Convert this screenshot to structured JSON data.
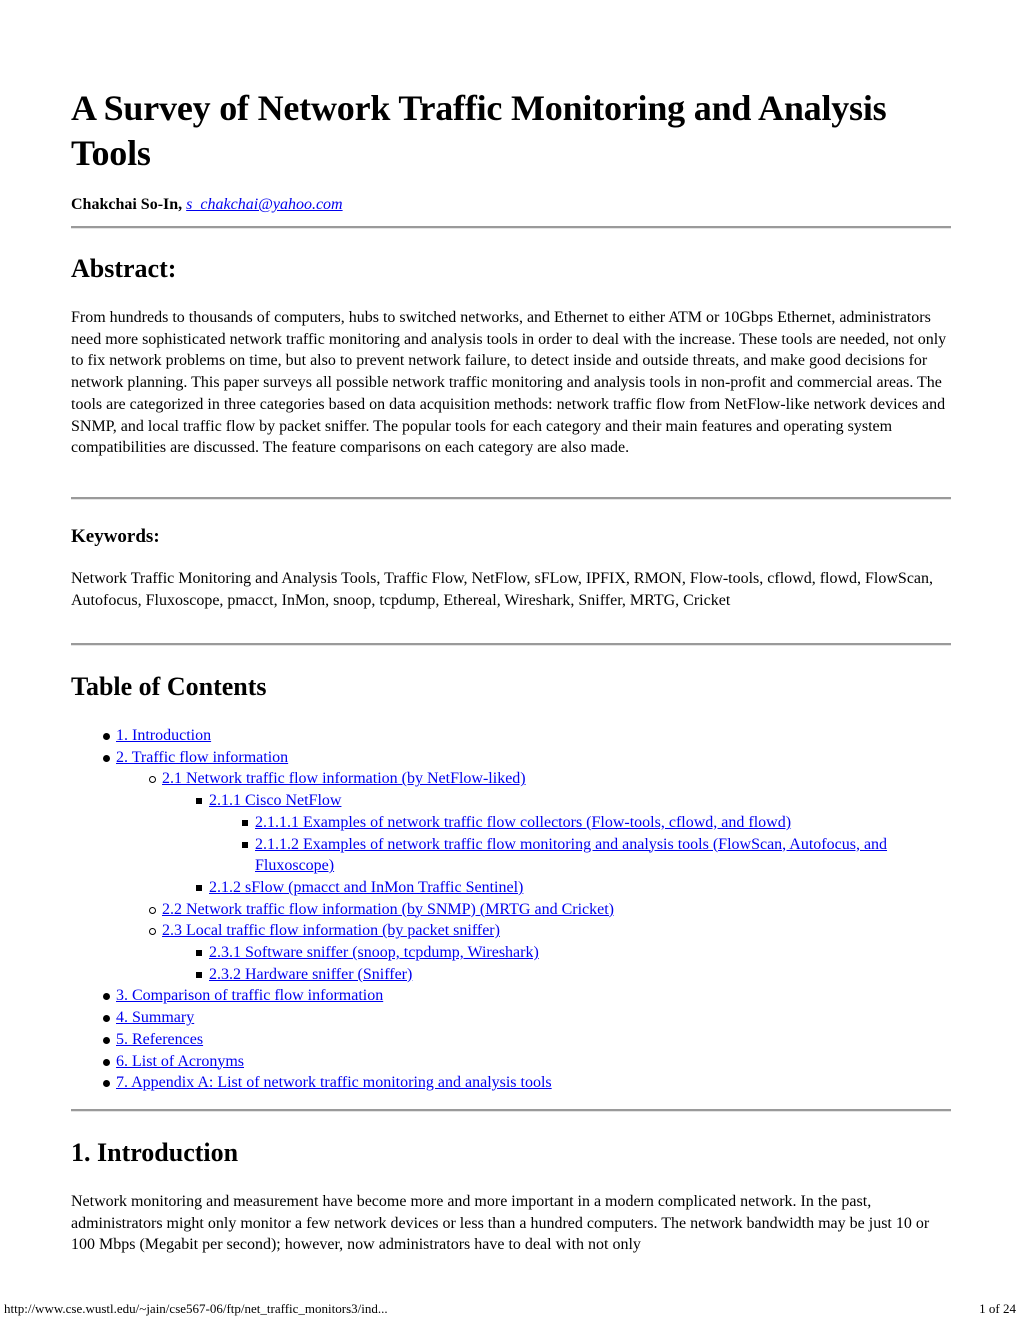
{
  "document": {
    "title": "A Survey of Network Traffic Monitoring and Analysis Tools",
    "author": {
      "name": "Chakchai So-In,",
      "email": "s_chakchai@yahoo.com"
    },
    "abstract": {
      "heading": "Abstract:",
      "text": "From hundreds to thousands of computers, hubs to switched networks, and Ethernet to either ATM or 10Gbps Ethernet, administrators need more sophisticated network traffic monitoring and analysis tools in order to deal with the increase. These tools are needed, not only to fix network problems on time, but also to prevent network failure, to detect inside and outside threats, and make good decisions for network planning. This paper surveys all possible network traffic monitoring and analysis tools in non-profit and commercial areas. The tools are categorized in three categories based on data acquisition methods: network traffic flow from NetFlow-like network devices and SNMP, and local traffic flow by packet sniffer. The popular tools for each category and their main features and operating system compatibilities are discussed. The feature comparisons on each category are also made."
    },
    "keywords": {
      "heading": "Keywords:",
      "text": "Network Traffic Monitoring and Analysis Tools, Traffic Flow, NetFlow, sFLow, IPFIX, RMON, Flow-tools, cflowd, flowd, FlowScan, Autofocus, Fluxoscope, pmacct, InMon, snoop, tcpdump, Ethereal, Wireshark, Sniffer, MRTG, Cricket"
    },
    "toc": {
      "heading": "Table of Contents",
      "items": [
        {
          "level": 0,
          "label": "1. Introduction"
        },
        {
          "level": 0,
          "label": "2. Traffic flow information"
        },
        {
          "level": 1,
          "label": "2.1 Network traffic flow information (by NetFlow-liked)"
        },
        {
          "level": 2,
          "label": "2.1.1 Cisco NetFlow"
        },
        {
          "level": 3,
          "label": "2.1.1.1 Examples of network traffic flow collectors (Flow-tools, cflowd, and flowd)"
        },
        {
          "level": 3,
          "label": "2.1.1.2 Examples of network traffic flow monitoring and analysis tools (FlowScan, Autofocus, and Fluxoscope)"
        },
        {
          "level": 2,
          "label": "2.1.2 sFlow (pmacct and InMon Traffic Sentinel)"
        },
        {
          "level": 1,
          "label": "2.2 Network traffic flow information (by SNMP) (MRTG and Cricket)"
        },
        {
          "level": 1,
          "label": "2.3 Local traffic flow information (by packet sniffer)"
        },
        {
          "level": 2,
          "label": "2.3.1 Software sniffer (snoop, tcpdump, Wireshark)"
        },
        {
          "level": 2,
          "label": "2.3.2 Hardware sniffer (Sniffer)"
        },
        {
          "level": 0,
          "label": "3. Comparison of traffic flow information"
        },
        {
          "level": 0,
          "label": "4. Summary"
        },
        {
          "level": 0,
          "label": "5. References"
        },
        {
          "level": 0,
          "label": "6. List of Acronyms"
        },
        {
          "level": 0,
          "label": "7. Appendix A: List of network traffic monitoring and analysis tools"
        }
      ]
    },
    "introduction": {
      "heading": "1. Introduction",
      "text": "Network monitoring and measurement have become more and more important in a modern complicated network. In the past, administrators might only monitor a few network devices or less than a hundred computers. The network bandwidth may be just 10 or 100 Mbps (Megabit per second); however, now administrators have to deal with not only"
    }
  },
  "footer": {
    "url": "http://www.cse.wustl.edu/~jain/cse567-06/ftp/net_traffic_monitors3/ind...",
    "page": "1 of 24"
  }
}
